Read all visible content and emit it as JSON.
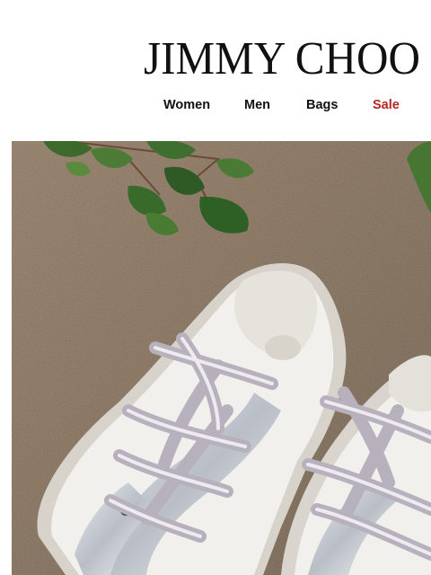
{
  "brand": {
    "name": "JIMMY CHOO"
  },
  "nav": {
    "items": [
      {
        "label": "Women",
        "color": "#111111"
      },
      {
        "label": "Men",
        "color": "#111111"
      },
      {
        "label": "Bags",
        "color": "#111111"
      },
      {
        "label": "Sale",
        "color": "#b3261e"
      }
    ]
  },
  "hero": {
    "colors": {
      "ground": "#8f7a64",
      "leaf": "#3d6a2e",
      "sneaker": "#f1efea",
      "lace": "#b7b1bd"
    }
  }
}
